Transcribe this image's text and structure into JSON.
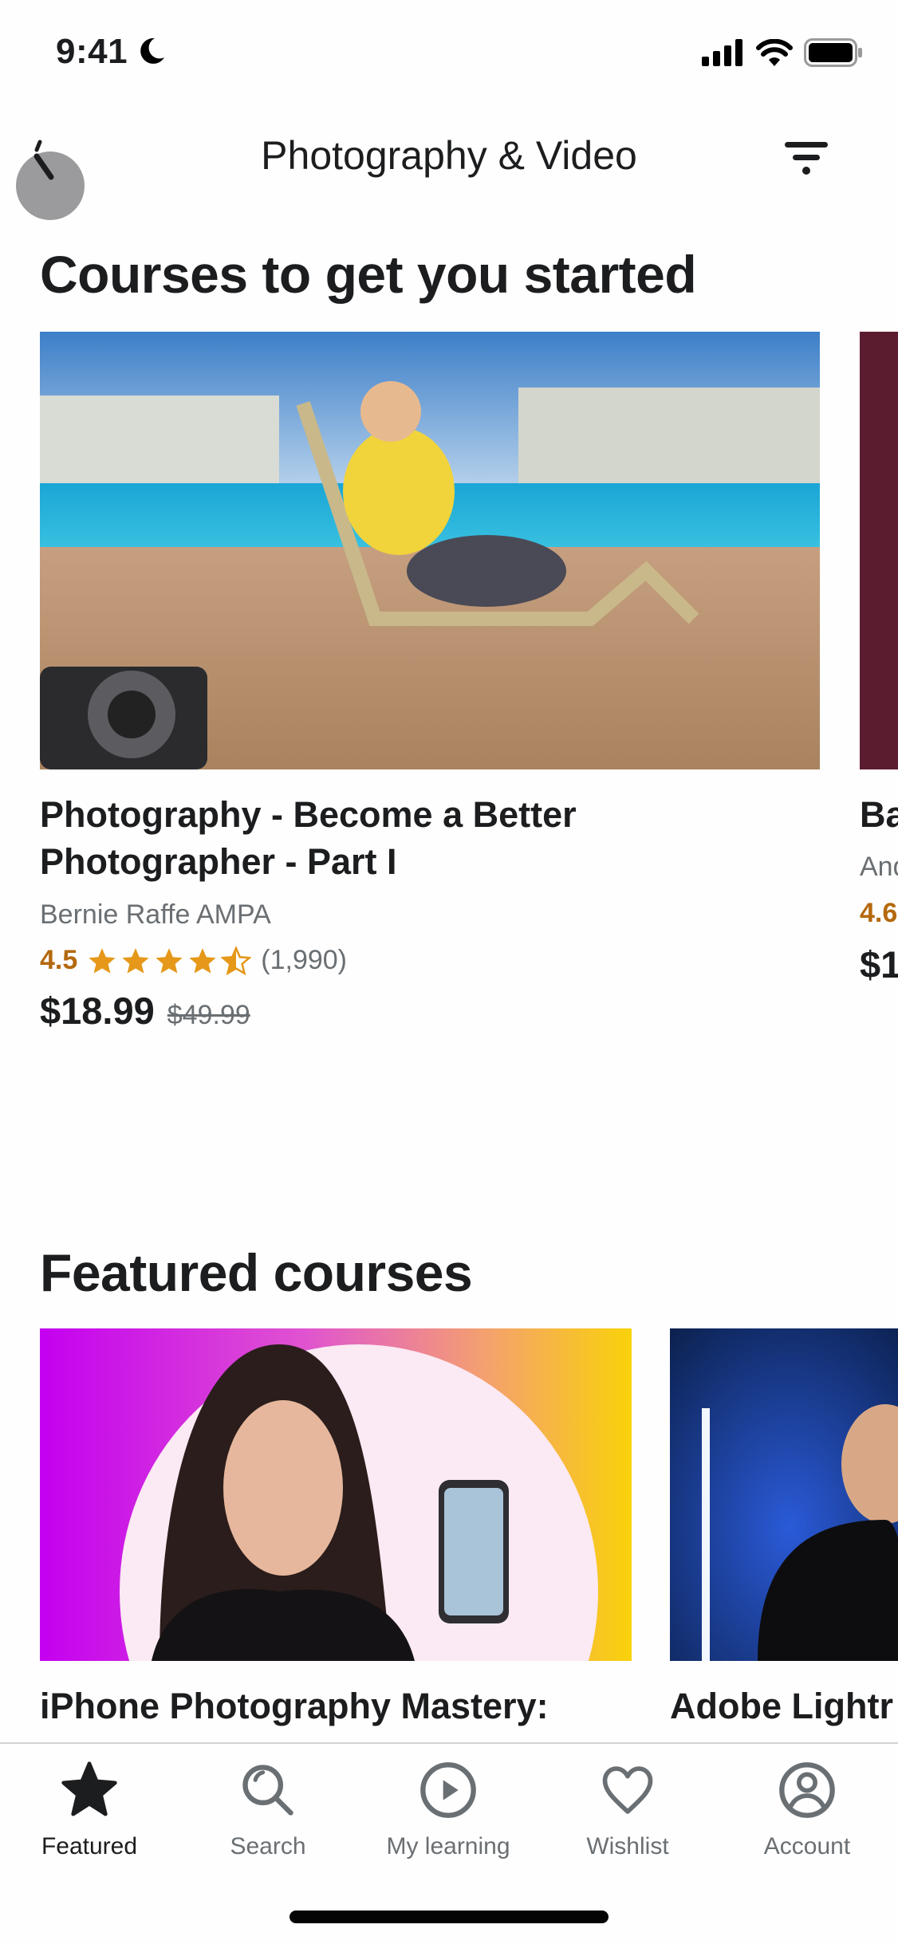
{
  "status_bar": {
    "time": "9:41",
    "icons": [
      "moon-icon",
      "cellular-signal-icon",
      "wifi-icon",
      "battery-icon"
    ]
  },
  "nav": {
    "title": "Photography & Video",
    "back_icon": "back-icon",
    "filter_icon": "filter-icon"
  },
  "sections": {
    "started": {
      "heading": "Courses to get you started",
      "cards": [
        {
          "title_line1": "Photography - Become a Better",
          "title_line2": "Photographer - Part I",
          "author": "Bernie Raffe AMPA",
          "rating": "4.5",
          "stars": 4.5,
          "reviews": "(1,990)",
          "price": "$18.99",
          "original_price": "$49.99"
        },
        {
          "title_line1": "Ba",
          "author": "And",
          "rating": "4.6",
          "price": "$1"
        }
      ]
    },
    "featured": {
      "heading": "Featured courses",
      "cards": [
        {
          "title_line1": "iPhone Photography Mastery:"
        },
        {
          "title_line1": "Adobe Lightr"
        }
      ]
    }
  },
  "tabbar": {
    "items": [
      {
        "label": "Featured",
        "icon": "star-icon",
        "active": true
      },
      {
        "label": "Search",
        "icon": "search-icon",
        "active": false
      },
      {
        "label": "My learning",
        "icon": "play-circle-icon",
        "active": false
      },
      {
        "label": "Wishlist",
        "icon": "heart-icon",
        "active": false
      },
      {
        "label": "Account",
        "icon": "account-icon",
        "active": false
      }
    ]
  },
  "colors": {
    "text": "#1c1d1f",
    "muted": "#6a6f73",
    "rating": "#b4690e",
    "star": "#e59819",
    "second_card_bg": "#5c1c30"
  }
}
